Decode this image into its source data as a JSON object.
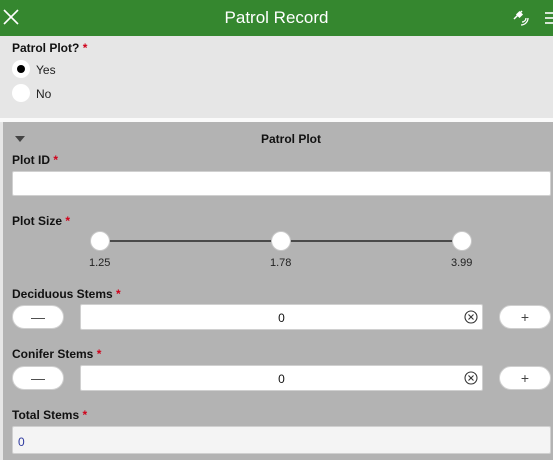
{
  "header": {
    "title": "Patrol Record",
    "close_icon": "close-icon",
    "gps_icon": "satellite-gps-icon",
    "menu_icon": "menu-icon",
    "color": "#35872f"
  },
  "patrol_plot_question": {
    "label": "Patrol Plot?",
    "required_mark": "*",
    "options": [
      {
        "label": "Yes",
        "selected": true
      },
      {
        "label": "No",
        "selected": false
      }
    ]
  },
  "group": {
    "title": "Patrol Plot",
    "chevron_icon": "chevron-down-icon"
  },
  "plot_id": {
    "label": "Plot ID",
    "required_mark": "*",
    "value": ""
  },
  "plot_size": {
    "label": "Plot Size",
    "required_mark": "*",
    "ticks": [
      "1.25",
      "1.78",
      "3.99"
    ]
  },
  "deciduous_stems": {
    "label": "Deciduous Stems",
    "required_mark": "*",
    "value": "0",
    "minus": "—",
    "plus": "+",
    "clear_icon": "clear-icon"
  },
  "conifer_stems": {
    "label": "Conifer Stems",
    "required_mark": "*",
    "value": "0",
    "minus": "—",
    "plus": "+",
    "clear_icon": "clear-icon"
  },
  "total_stems": {
    "label": "Total Stems",
    "required_mark": "*",
    "value": "0"
  }
}
